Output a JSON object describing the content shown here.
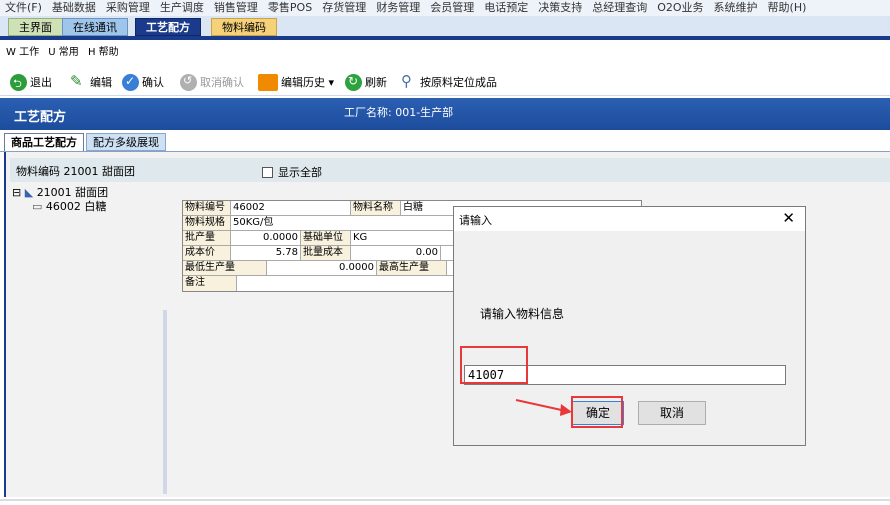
{
  "menu_bar": [
    "文件(F)",
    "基础数据",
    "采购管理",
    "生产调度",
    "销售管理",
    "零售POS",
    "存货管理",
    "财务管理",
    "会员管理",
    "电话预定",
    "决策支持",
    "总经理查询",
    "O2O业务",
    "系统维护",
    "帮助(H)"
  ],
  "nav_tabs": [
    "主界面",
    "在线通讯",
    "工艺配方",
    "物料编码"
  ],
  "submenu": [
    "W 工作",
    "U 常用",
    "H 帮助"
  ],
  "toolbar": {
    "exit": "退出",
    "edit": "编辑",
    "confirm": "确认",
    "cancel_confirm": "取消确认",
    "history": "编辑历史 ▾",
    "refresh": "刷新",
    "locate": "按原料定位成品"
  },
  "page": {
    "title": "工艺配方",
    "factory": "工厂名称: 001-生产部"
  },
  "sub_tabs": [
    "商品工艺配方",
    "配方多级展现"
  ],
  "filter": {
    "material_code": "物料编码 21001 甜面团",
    "show_all": "显示全部"
  },
  "tree": {
    "root": "21001 甜面团",
    "child": "46002 白糖"
  },
  "detail": {
    "code_label": "物料编号",
    "code": "46002",
    "name_label": "物料名称",
    "name": "白糖",
    "spec_label": "物料规格",
    "spec": "50KG/包",
    "batch_label": "批产量",
    "batch": "0.0000",
    "unit_label": "基础单位",
    "unit": "KG",
    "cost_label": "成本价",
    "cost": "5.78",
    "batch_cost_label": "批量成本",
    "batch_cost": "0.00",
    "min_label": "最低生产量",
    "min": "0.0000",
    "max_label": "最高生产量",
    "note_label": "备注"
  },
  "dialog": {
    "title": "请输入",
    "close": "✕",
    "message": "请输入物料信息",
    "input_value": "41007",
    "ok": "确定",
    "cancel": "取消"
  },
  "colors": {
    "primary": "#1a3a8c",
    "highlight": "#e8383a"
  }
}
